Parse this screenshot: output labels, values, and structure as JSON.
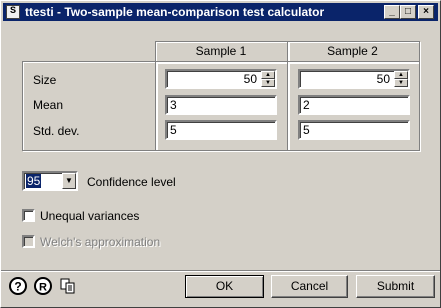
{
  "window": {
    "app_icon": "stata-icon",
    "title": "ttesti - Two-sample mean-comparison test calculator",
    "controls": {
      "minimize": "_",
      "maximize": "□",
      "close": "×"
    }
  },
  "grid": {
    "sample1_header": "Sample 1",
    "sample2_header": "Sample 2",
    "size_label": "Size",
    "mean_label": "Mean",
    "sd_label": "Std. dev.",
    "size1": "50",
    "size2": "50",
    "mean1": "3",
    "mean2": "2",
    "sd1": "5",
    "sd2": "5"
  },
  "confidence": {
    "value": "95",
    "label": "Confidence level"
  },
  "options": {
    "unequal_label": "Unequal variances",
    "unequal_checked": false,
    "welch_label": "Welch's approximation",
    "welch_checked": false,
    "welch_enabled": false
  },
  "footer": {
    "help_icon": "help-icon",
    "reset_icon": "reset-icon",
    "copy_icon": "copy-icon",
    "ok_label": "OK",
    "cancel_label": "Cancel",
    "submit_label": "Submit"
  },
  "colors": {
    "titlebar": "#0a246a",
    "face": "#d4d0c8",
    "selection": "#0a246a"
  }
}
